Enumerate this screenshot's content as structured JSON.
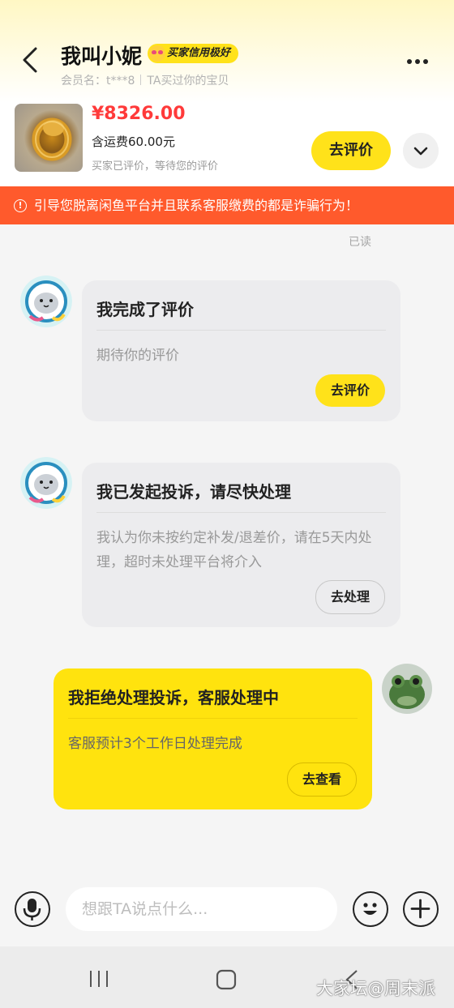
{
  "header": {
    "title": "我叫小妮",
    "badge": "买家信用极好",
    "member_label": "会员名：t***8",
    "relation": "TA买过你的宝贝"
  },
  "product": {
    "price": "¥8326.00",
    "shipping": "含运费60.00元",
    "status": "买家已评价，等待您的评价",
    "action_label": "去评价"
  },
  "warning": {
    "icon": "!",
    "text": "引导您脱离闲鱼平台并且联系客服缴费的都是诈骗行为！"
  },
  "read_status": "已读",
  "messages": [
    {
      "title": "我完成了评价",
      "body": "期待你的评价",
      "button": "去评价"
    },
    {
      "title": "我已发起投诉，请尽快处理",
      "body": "我认为你未按约定补发/退差价，请在5天内处理，超时未处理平台将介入",
      "button": "去处理"
    },
    {
      "title": "我拒绝处理投诉，客服处理中",
      "body": "客服预计3个工作日处理完成",
      "button": "去查看"
    }
  ],
  "input": {
    "placeholder": "想跟TA说点什么..."
  },
  "watermark": "大家坛@周末派",
  "colors": {
    "accent": "#ffe21a",
    "warning": "#ff5a2c",
    "price": "#ff3a3a"
  }
}
